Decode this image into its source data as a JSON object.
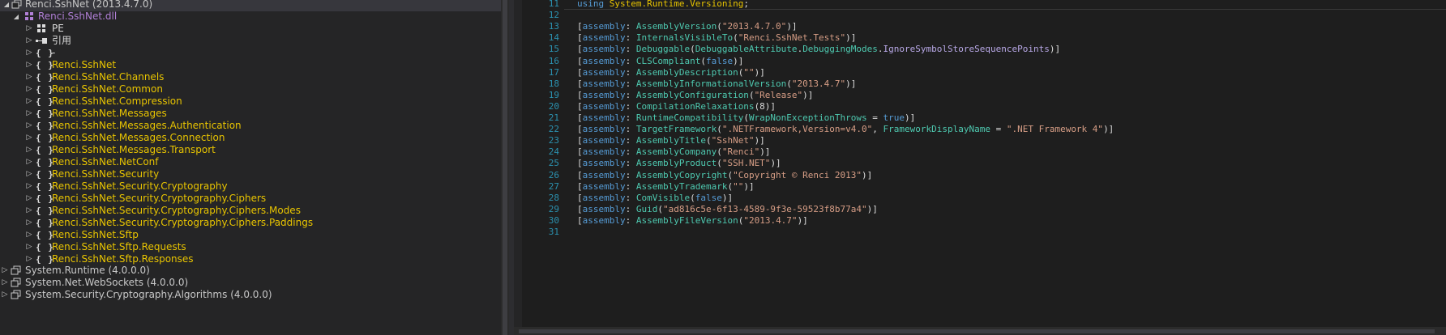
{
  "tree": {
    "root": {
      "label": "Renci.SshNet (2013.4.7.0)",
      "toggle": "▲"
    },
    "dll": {
      "label": "Renci.SshNet.dll"
    },
    "pe": {
      "label": "PE"
    },
    "refs": {
      "label": "引用"
    },
    "dash": {
      "label": "-"
    },
    "namespaces": [
      "Renci.SshNet",
      "Renci.SshNet.Channels",
      "Renci.SshNet.Common",
      "Renci.SshNet.Compression",
      "Renci.SshNet.Messages",
      "Renci.SshNet.Messages.Authentication",
      "Renci.SshNet.Messages.Connection",
      "Renci.SshNet.Messages.Transport",
      "Renci.SshNet.NetConf",
      "Renci.SshNet.Security",
      "Renci.SshNet.Security.Cryptography",
      "Renci.SshNet.Security.Cryptography.Ciphers",
      "Renci.SshNet.Security.Cryptography.Ciphers.Modes",
      "Renci.SshNet.Security.Cryptography.Ciphers.Paddings",
      "Renci.SshNet.Sftp",
      "Renci.SshNet.Sftp.Requests",
      "Renci.SshNet.Sftp.Responses"
    ],
    "assemblies": [
      "System.Runtime (4.0.0.0)",
      "System.Net.WebSockets (4.0.0.0)",
      "System.Security.Cryptography.Algorithms (4.0.0.0)"
    ],
    "ns_icon": "{ }",
    "collapsed_glyph": "▷",
    "expanded_glyph": "◢"
  },
  "editor": {
    "lines": [
      {
        "n": "11",
        "tokens": [
          [
            "kw",
            "using"
          ],
          [
            "",
            " "
          ],
          [
            "yel",
            "System.Runtime.Versioning"
          ],
          [
            "",
            ";"
          ]
        ]
      },
      {
        "n": "12",
        "tokens": []
      },
      {
        "n": "13",
        "tokens": [
          [
            "",
            "["
          ],
          [
            "kw",
            "assembly"
          ],
          [
            "",
            ": "
          ],
          [
            "ty",
            "AssemblyVersion"
          ],
          [
            "",
            "("
          ],
          [
            "st",
            "\"2013.4.7.0\""
          ],
          [
            "",
            ")]"
          ]
        ]
      },
      {
        "n": "14",
        "tokens": [
          [
            "",
            "["
          ],
          [
            "kw",
            "assembly"
          ],
          [
            "",
            ": "
          ],
          [
            "ty",
            "InternalsVisibleTo"
          ],
          [
            "",
            "("
          ],
          [
            "st",
            "\"Renci.SshNet.Tests\""
          ],
          [
            "",
            ")]"
          ]
        ]
      },
      {
        "n": "15",
        "tokens": [
          [
            "",
            "["
          ],
          [
            "kw",
            "assembly"
          ],
          [
            "",
            ": "
          ],
          [
            "ty",
            "Debuggable"
          ],
          [
            "",
            "("
          ],
          [
            "ty",
            "DebuggableAttribute"
          ],
          [
            "",
            "."
          ],
          [
            "ty",
            "DebuggingModes"
          ],
          [
            "",
            "."
          ],
          [
            "en",
            "IgnoreSymbolStoreSequencePoints"
          ],
          [
            "",
            ")]"
          ]
        ]
      },
      {
        "n": "16",
        "tokens": [
          [
            "",
            "["
          ],
          [
            "kw",
            "assembly"
          ],
          [
            "",
            ": "
          ],
          [
            "ty",
            "CLSCompliant"
          ],
          [
            "",
            "("
          ],
          [
            "kw",
            "false"
          ],
          [
            "",
            ")]"
          ]
        ]
      },
      {
        "n": "17",
        "tokens": [
          [
            "",
            "["
          ],
          [
            "kw",
            "assembly"
          ],
          [
            "",
            ": "
          ],
          [
            "ty",
            "AssemblyDescription"
          ],
          [
            "",
            "("
          ],
          [
            "st",
            "\"\""
          ],
          [
            "",
            ")]"
          ]
        ]
      },
      {
        "n": "18",
        "tokens": [
          [
            "",
            "["
          ],
          [
            "kw",
            "assembly"
          ],
          [
            "",
            ": "
          ],
          [
            "ty",
            "AssemblyInformationalVersion"
          ],
          [
            "",
            "("
          ],
          [
            "st",
            "\"2013.4.7\""
          ],
          [
            "",
            ")]"
          ]
        ]
      },
      {
        "n": "19",
        "tokens": [
          [
            "",
            "["
          ],
          [
            "kw",
            "assembly"
          ],
          [
            "",
            ": "
          ],
          [
            "ty",
            "AssemblyConfiguration"
          ],
          [
            "",
            "("
          ],
          [
            "st",
            "\"Release\""
          ],
          [
            "",
            ")]"
          ]
        ]
      },
      {
        "n": "20",
        "tokens": [
          [
            "",
            "["
          ],
          [
            "kw",
            "assembly"
          ],
          [
            "",
            ": "
          ],
          [
            "ty",
            "CompilationRelaxations"
          ],
          [
            "",
            "(8)]"
          ]
        ]
      },
      {
        "n": "21",
        "tokens": [
          [
            "",
            "["
          ],
          [
            "kw",
            "assembly"
          ],
          [
            "",
            ": "
          ],
          [
            "ty",
            "RuntimeCompatibility"
          ],
          [
            "",
            "("
          ],
          [
            "pn",
            "WrapNonExceptionThrows"
          ],
          [
            "",
            " = "
          ],
          [
            "kw",
            "true"
          ],
          [
            "",
            ")]"
          ]
        ]
      },
      {
        "n": "22",
        "tokens": [
          [
            "",
            "["
          ],
          [
            "kw",
            "assembly"
          ],
          [
            "",
            ": "
          ],
          [
            "ty",
            "TargetFramework"
          ],
          [
            "",
            "("
          ],
          [
            "st",
            "\".NETFramework,Version=v4.0\""
          ],
          [
            "",
            ", "
          ],
          [
            "pn",
            "FrameworkDisplayName"
          ],
          [
            "",
            " = "
          ],
          [
            "st",
            "\".NET Framework 4\""
          ],
          [
            "",
            ")]"
          ]
        ]
      },
      {
        "n": "23",
        "tokens": [
          [
            "",
            "["
          ],
          [
            "kw",
            "assembly"
          ],
          [
            "",
            ": "
          ],
          [
            "ty",
            "AssemblyTitle"
          ],
          [
            "",
            "("
          ],
          [
            "st",
            "\"SshNet\""
          ],
          [
            "",
            ")]"
          ]
        ]
      },
      {
        "n": "24",
        "tokens": [
          [
            "",
            "["
          ],
          [
            "kw",
            "assembly"
          ],
          [
            "",
            ": "
          ],
          [
            "ty",
            "AssemblyCompany"
          ],
          [
            "",
            "("
          ],
          [
            "st",
            "\"Renci\""
          ],
          [
            "",
            ")]"
          ]
        ]
      },
      {
        "n": "25",
        "tokens": [
          [
            "",
            "["
          ],
          [
            "kw",
            "assembly"
          ],
          [
            "",
            ": "
          ],
          [
            "ty",
            "AssemblyProduct"
          ],
          [
            "",
            "("
          ],
          [
            "st",
            "\"SSH.NET\""
          ],
          [
            "",
            ")]"
          ]
        ]
      },
      {
        "n": "26",
        "tokens": [
          [
            "",
            "["
          ],
          [
            "kw",
            "assembly"
          ],
          [
            "",
            ": "
          ],
          [
            "ty",
            "AssemblyCopyright"
          ],
          [
            "",
            "("
          ],
          [
            "st",
            "\"Copyright © Renci 2013\""
          ],
          [
            "",
            ")]"
          ]
        ]
      },
      {
        "n": "27",
        "tokens": [
          [
            "",
            "["
          ],
          [
            "kw",
            "assembly"
          ],
          [
            "",
            ": "
          ],
          [
            "ty",
            "AssemblyTrademark"
          ],
          [
            "",
            "("
          ],
          [
            "st",
            "\"\""
          ],
          [
            "",
            ")]"
          ]
        ]
      },
      {
        "n": "28",
        "tokens": [
          [
            "",
            "["
          ],
          [
            "kw",
            "assembly"
          ],
          [
            "",
            ": "
          ],
          [
            "ty",
            "ComVisible"
          ],
          [
            "",
            "("
          ],
          [
            "kw",
            "false"
          ],
          [
            "",
            ")]"
          ]
        ]
      },
      {
        "n": "29",
        "tokens": [
          [
            "",
            "["
          ],
          [
            "kw",
            "assembly"
          ],
          [
            "",
            ": "
          ],
          [
            "ty",
            "Guid"
          ],
          [
            "",
            "("
          ],
          [
            "st",
            "\"ad816c5e-6f13-4589-9f3e-59523f8b77a4\""
          ],
          [
            "",
            ")]"
          ]
        ]
      },
      {
        "n": "30",
        "tokens": [
          [
            "",
            "["
          ],
          [
            "kw",
            "assembly"
          ],
          [
            "",
            ": "
          ],
          [
            "ty",
            "AssemblyFileVersion"
          ],
          [
            "",
            "("
          ],
          [
            "st",
            "\"2013.4.7\""
          ],
          [
            "",
            ")]"
          ]
        ]
      },
      {
        "n": "31",
        "tokens": []
      }
    ]
  },
  "colors": {
    "namespace": "#e8c400",
    "dll": "#b180d7",
    "keyword": "#569cd6",
    "type": "#4ec9b0",
    "string": "#d69d85",
    "line_number": "#2b91af"
  }
}
